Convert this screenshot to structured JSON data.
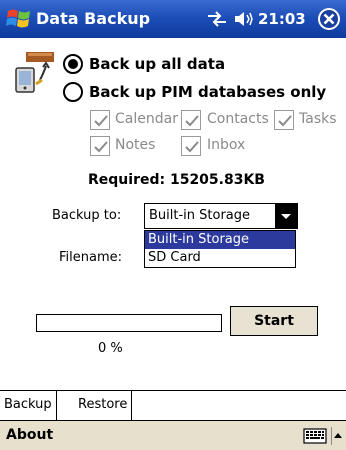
{
  "titlebar": {
    "title": "Data Backup",
    "time": "21:03",
    "icons": [
      "windows-start-icon",
      "connectivity-icon",
      "volume-icon",
      "close-icon"
    ]
  },
  "options": {
    "backup_all_label": "Back up all data",
    "backup_pim_label": "Back up PIM databases only",
    "selected": "all"
  },
  "pim_items": [
    {
      "label": "Calendar",
      "checked": true
    },
    {
      "label": "Contacts",
      "checked": true
    },
    {
      "label": "Tasks",
      "checked": true
    },
    {
      "label": "Notes",
      "checked": true
    },
    {
      "label": "Inbox",
      "checked": true
    }
  ],
  "required": "Required: 15205.83KB",
  "backup_to": {
    "label": "Backup to:",
    "value": "Built-in Storage",
    "options": [
      "Built-in Storage",
      "SD Card"
    ]
  },
  "filename": {
    "label": "Filename:"
  },
  "progress": {
    "value": 0,
    "text": "0 %"
  },
  "start_label": "Start",
  "tabs": [
    {
      "label": "Backup",
      "active": true
    },
    {
      "label": "Restore",
      "active": false
    }
  ],
  "menubar": {
    "about_label": "About"
  },
  "colors": {
    "titlebar": "#1d4fb8",
    "selection": "#2c3a9e",
    "menubar": "#e6e0cd",
    "button": "#e8e2d2",
    "disabled_text": "#8a8a8a"
  }
}
